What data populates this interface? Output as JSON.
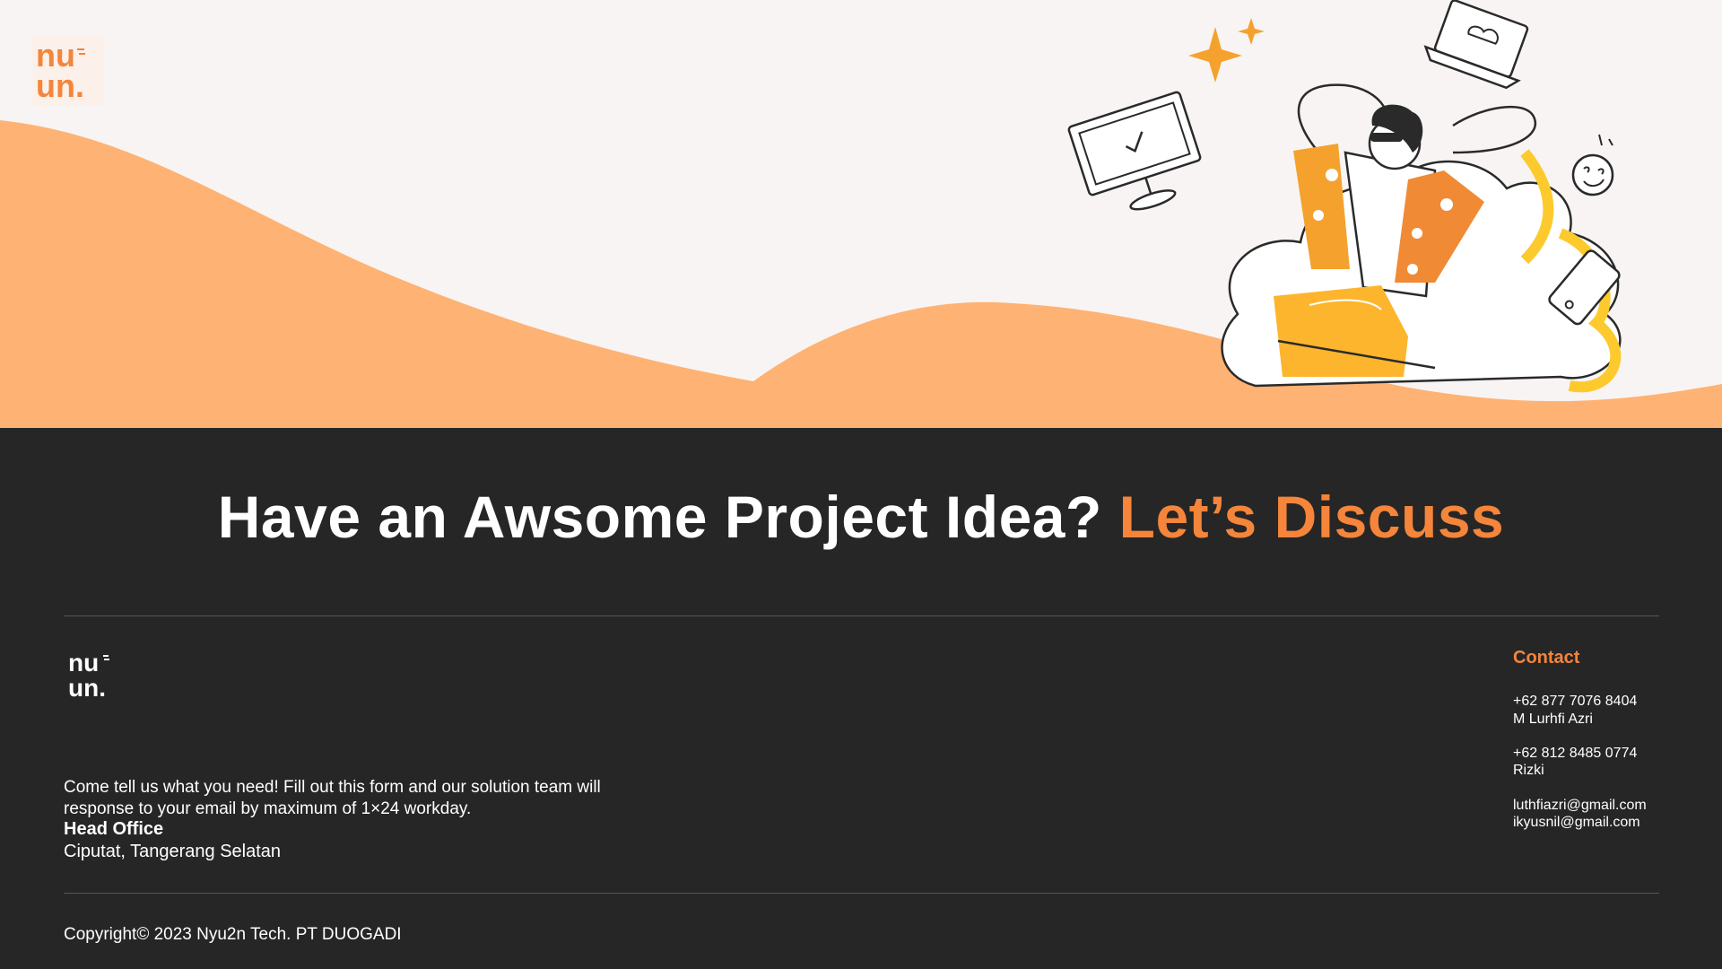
{
  "brand": {
    "logo_top_line": "nu",
    "logo_bottom_line": "un.",
    "colors": {
      "accent": "#f4853a",
      "wave": "#feb273",
      "dark": "#262626",
      "light": "#f8f4f3"
    }
  },
  "hero": {
    "illustration": "relaxing-person-illustration"
  },
  "headline": {
    "main": "Have an Awsome Project Idea?",
    "accent": "Let’s Discuss"
  },
  "footer": {
    "description": "Come tell us what you need! Fill out this form and our solution team will response to your email by maximum of 1×24 workday.",
    "head_office_label": "Head Office",
    "address": "Ciputat, Tangerang Selatan",
    "contact": {
      "title": "Contact",
      "phone_1": "+62 877 7076 8404",
      "name_1": "M Lurhfi Azri",
      "phone_2": "+62 812 8485 0774",
      "name_2": "Rizki",
      "email_1": "luthfiazri@gmail.com",
      "email_2": "ikyusnil@gmail.com"
    },
    "copyright": "Copyright© 2023 Nyu2n Tech. PT DUOGADI"
  }
}
